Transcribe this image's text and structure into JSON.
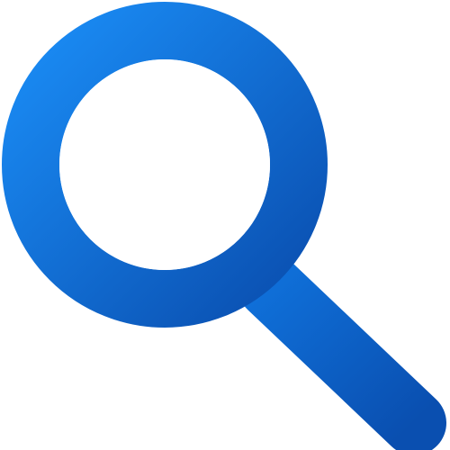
{
  "icon": {
    "name": "search-icon",
    "colors": {
      "light": "#1a8cf5",
      "mid": "#0f6fd8",
      "dark": "#0a4fb0",
      "background": "#ffffff"
    }
  }
}
